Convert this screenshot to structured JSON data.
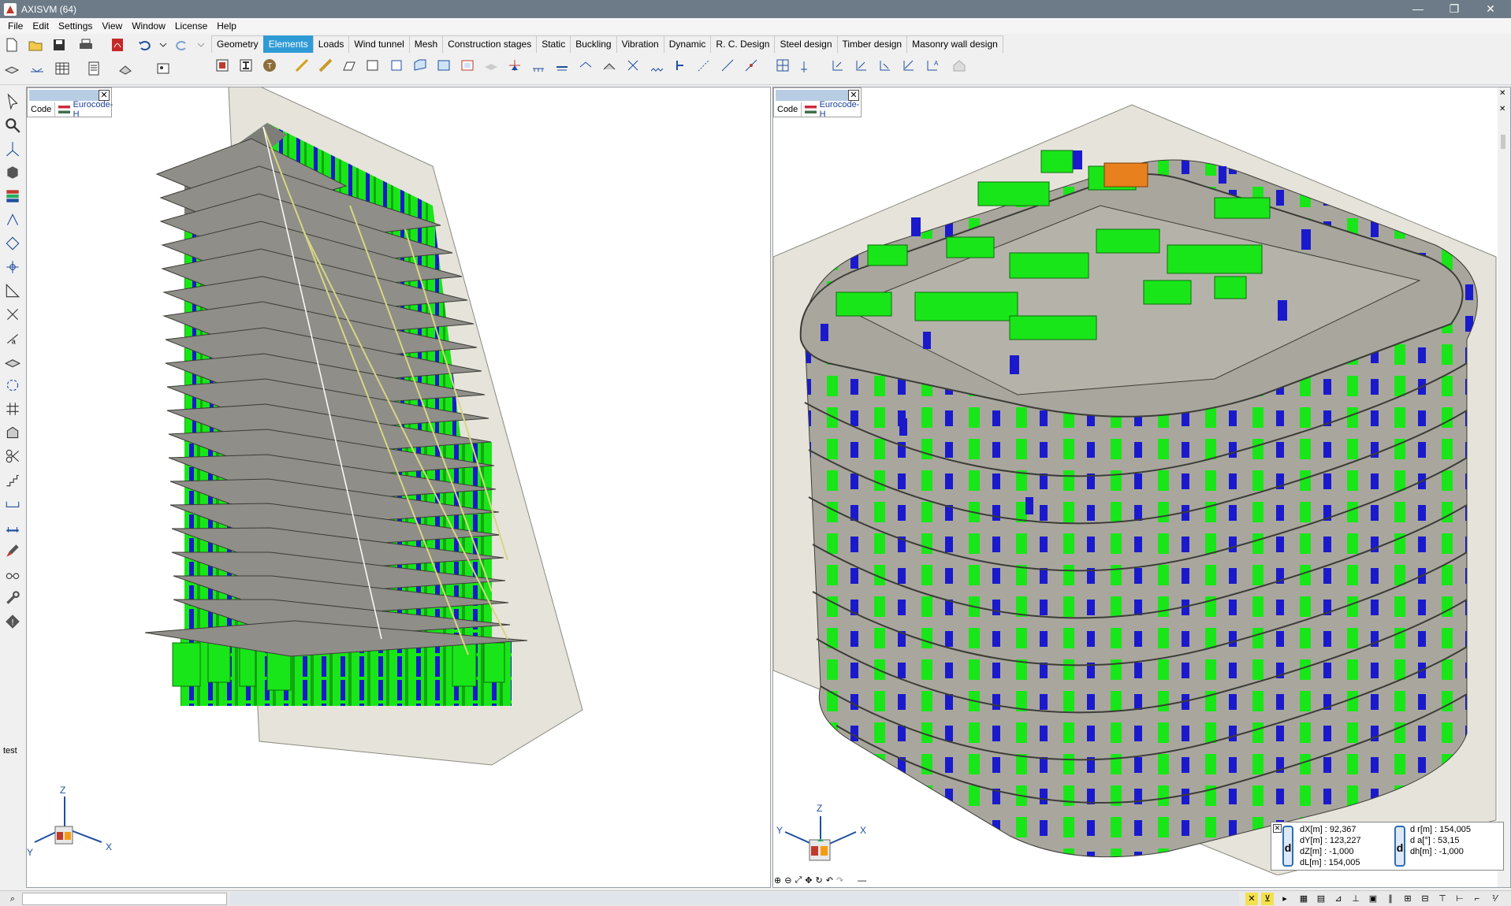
{
  "app": {
    "title": "AXISVM (64)"
  },
  "menu": [
    "File",
    "Edit",
    "Settings",
    "View",
    "Window",
    "License",
    "Help"
  ],
  "tabs": [
    {
      "label": "Geometry"
    },
    {
      "label": "Elements",
      "active": true
    },
    {
      "label": "Loads"
    },
    {
      "label": "Wind tunnel"
    },
    {
      "label": "Mesh"
    },
    {
      "label": "Construction stages"
    },
    {
      "label": "Static"
    },
    {
      "label": "Buckling"
    },
    {
      "label": "Vibration"
    },
    {
      "label": "Dynamic"
    },
    {
      "label": "R. C. Design"
    },
    {
      "label": "Steel design"
    },
    {
      "label": "Timber design"
    },
    {
      "label": "Masonry wall design"
    }
  ],
  "left_toolbar": {
    "test_label": "test"
  },
  "left_view": {
    "code_label": "Code",
    "code_value": "Eurocode-H"
  },
  "right_view": {
    "code_label": "Code",
    "code_value": "Eurocode-H"
  },
  "axes": {
    "z": "Z",
    "y": "Y",
    "x": "X"
  },
  "measure": {
    "left": [
      "dX[m]  :  92,367",
      "dY[m]  :  123,227",
      "dZ[m]  :  -1,000",
      "dL[m]  :  154,005"
    ],
    "right": [
      "d r[m]  :  154,005",
      "d  a[°]  :  53,15",
      "dh[m]  :  -1,000"
    ],
    "box_label": "d"
  },
  "colors": {
    "wall_green": "#19e619",
    "column_blue": "#1a1acc",
    "slab_gray": "#a9a79d",
    "accent_tab": "#2f9bd6",
    "orange": "#e8801e"
  }
}
